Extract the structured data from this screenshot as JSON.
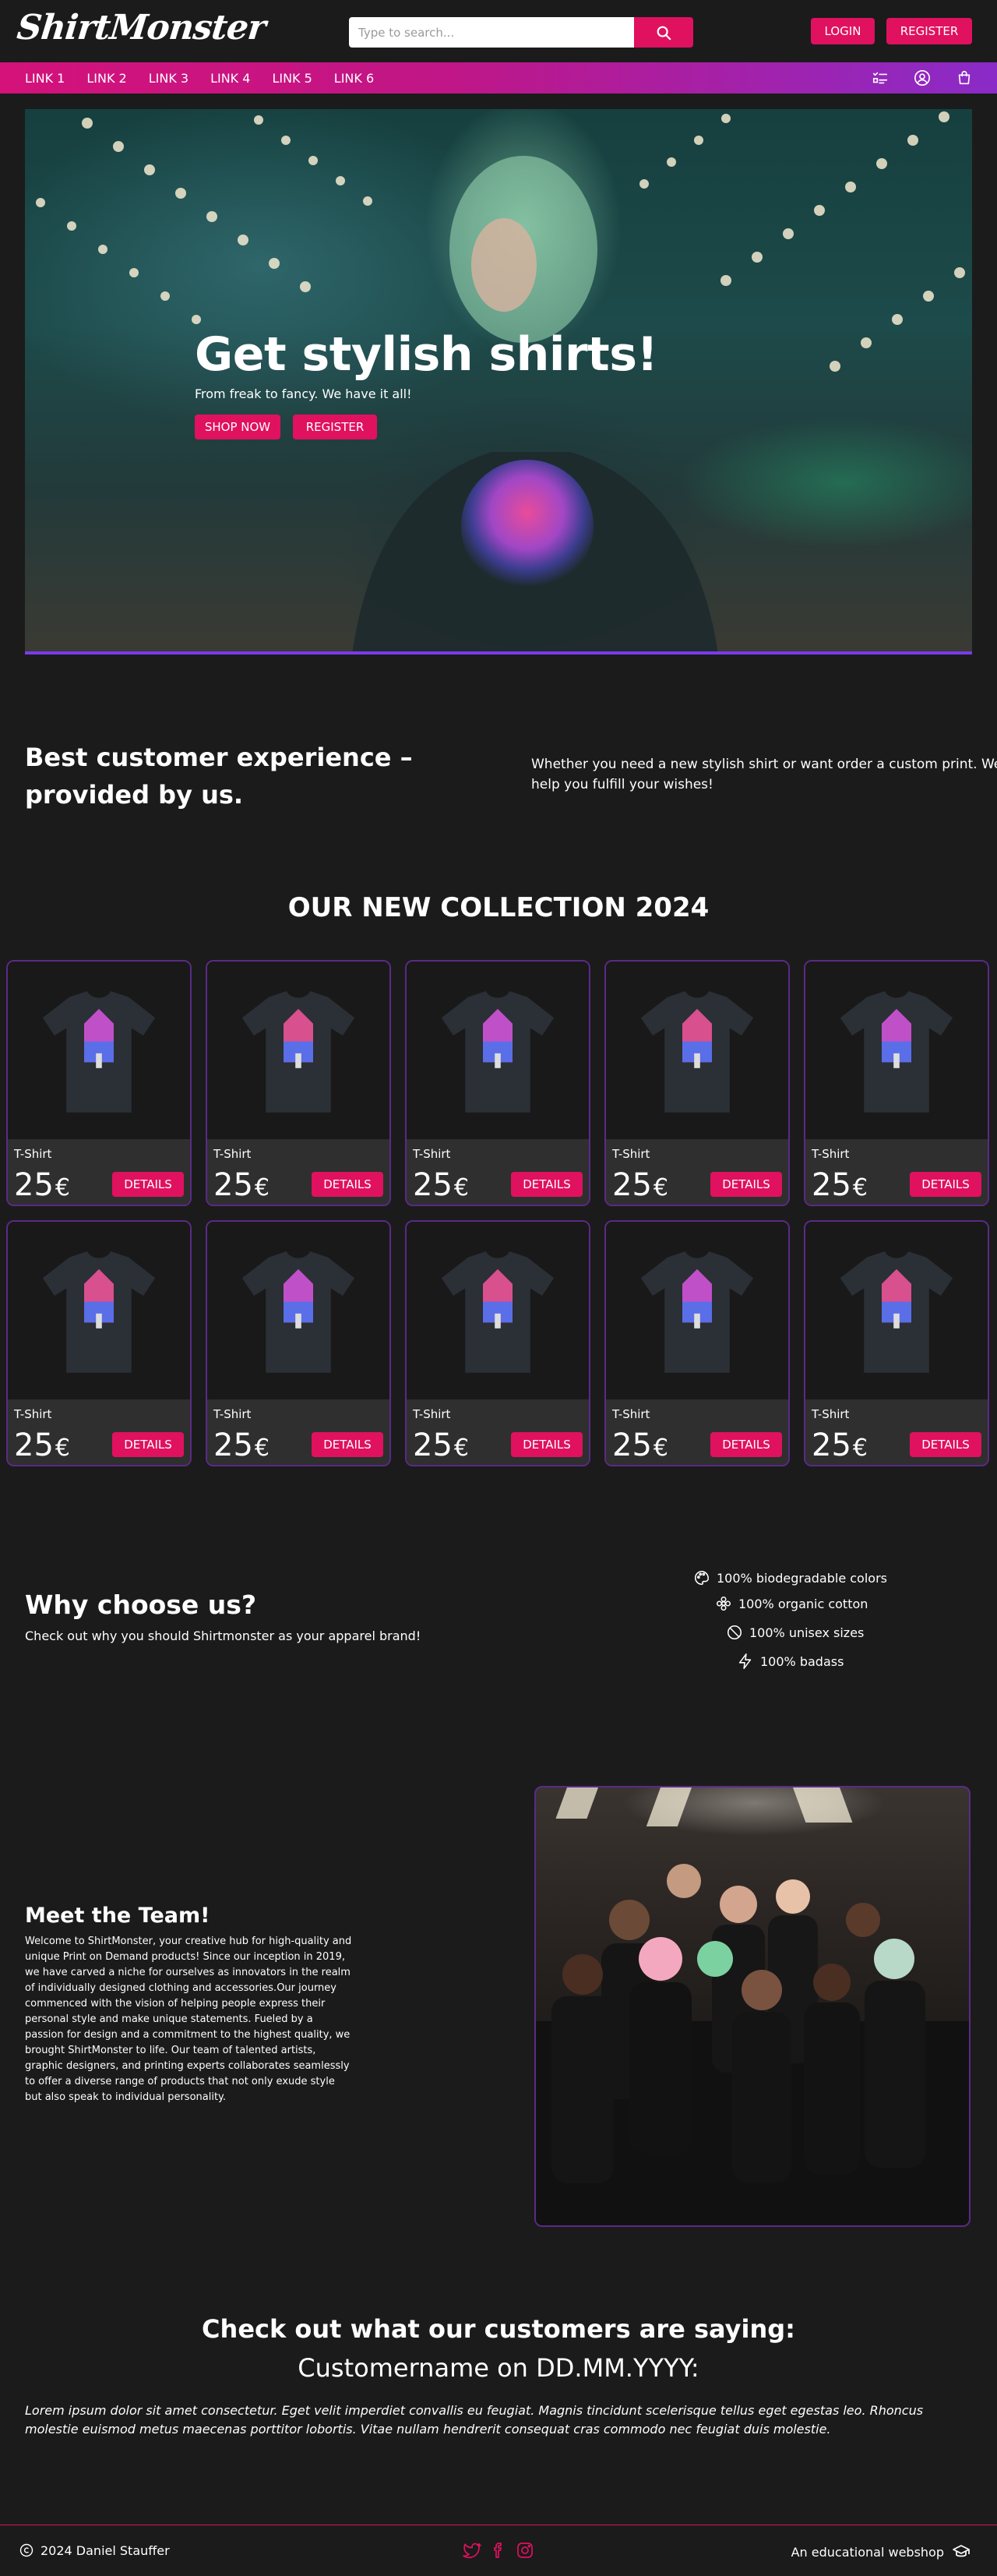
{
  "header": {
    "logo_text": "ShirtMonster",
    "search_placeholder": "Type to search...",
    "login_label": "LOGIN",
    "register_label": "REGISTER"
  },
  "nav": {
    "links": [
      "LINK 1",
      "LINK 2",
      "LINK 3",
      "LINK 4",
      "LINK 5",
      "LINK 6"
    ],
    "icons": [
      "checklist-icon",
      "user-icon",
      "cart-icon"
    ]
  },
  "hero": {
    "title": "Get stylish shirts!",
    "subtitle": "From freak to fancy. We have it all!",
    "shop_label": "SHOP NOW",
    "register_label": "REGISTER"
  },
  "experience": {
    "title": "Best customer experience – provided by us.",
    "text": "Whether you need a new stylish shirt or want order a custom print. We help you fulfill your wishes!"
  },
  "collection": {
    "title": "OUR NEW COLLECTION 2024",
    "products": [
      {
        "name": "T-Shirt",
        "price": "25",
        "currency": "€",
        "button": "DETAILS"
      },
      {
        "name": "T-Shirt",
        "price": "25",
        "currency": "€",
        "button": "DETAILS"
      },
      {
        "name": "T-Shirt",
        "price": "25",
        "currency": "€",
        "button": "DETAILS"
      },
      {
        "name": "T-Shirt",
        "price": "25",
        "currency": "€",
        "button": "DETAILS"
      },
      {
        "name": "T-Shirt",
        "price": "25",
        "currency": "€",
        "button": "DETAILS"
      },
      {
        "name": "T-Shirt",
        "price": "25",
        "currency": "€",
        "button": "DETAILS"
      },
      {
        "name": "T-Shirt",
        "price": "25",
        "currency": "€",
        "button": "DETAILS"
      },
      {
        "name": "T-Shirt",
        "price": "25",
        "currency": "€",
        "button": "DETAILS"
      },
      {
        "name": "T-Shirt",
        "price": "25",
        "currency": "€",
        "button": "DETAILS"
      },
      {
        "name": "T-Shirt",
        "price": "25",
        "currency": "€",
        "button": "DETAILS"
      }
    ]
  },
  "why": {
    "title": "Why choose us?",
    "subtitle": "Check out why you should Shirtmonster as your apparel brand!",
    "features": [
      {
        "icon": "palette-icon",
        "text": "100% biodegradable colors"
      },
      {
        "icon": "flower-icon",
        "text": "100% organic cotton"
      },
      {
        "icon": "no-symbol-icon",
        "text": "100% unisex sizes"
      },
      {
        "icon": "lightning-icon",
        "text": "100% badass"
      }
    ]
  },
  "team": {
    "title": "Meet the Team!",
    "text": "Welcome to ShirtMonster, your creative hub for high-quality and unique Print on Demand products! Since our inception in 2019, we have carved a niche for ourselves as innovators in the realm of individually designed clothing and accessories.Our journey commenced with the vision of helping people express their personal style and make unique statements. Fueled by a passion for design and a commitment to the highest quality, we brought ShirtMonster to life. Our team of talented artists, graphic designers, and printing experts collaborates seamlessly to offer a diverse range of products that not only exude style but also speak to individual personality."
  },
  "testimonial": {
    "title": "Check out what our customers are saying:",
    "customer": "Customername on DD.MM.YYYY:",
    "quote": "Lorem ipsum dolor sit amet consectetur. Eget velit imperdiet convallis eu feugiat. Magnis tincidunt scelerisque tellus eget egestas leo. Rhoncus molestie euismod metus maecenas porttitor lobortis. Vitae nullam hendrerit consequat cras commodo nec feugiat duis molestie."
  },
  "footer": {
    "copyright": "2024 Daniel Stauffer",
    "social_icons": [
      "twitter-icon",
      "facebook-icon",
      "instagram-icon"
    ],
    "edu_text": "An educational webshop"
  },
  "colors": {
    "accent": "#e0115f",
    "background": "#1b1b1b",
    "card_border": "#5b2a86",
    "gradient_end": "#8a2bc8"
  }
}
